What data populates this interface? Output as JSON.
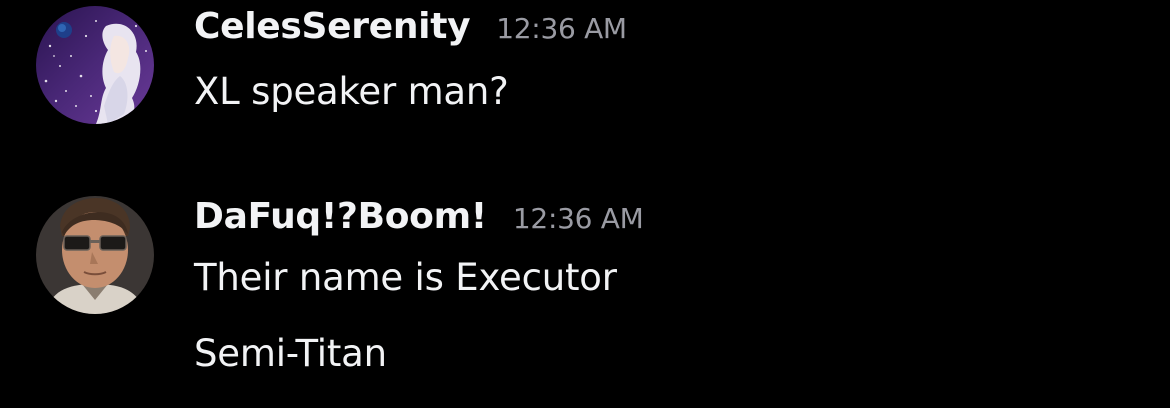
{
  "messages": [
    {
      "author": "CelesSerenity",
      "timestamp": "12:36 AM",
      "lines": [
        "XL speaker man?"
      ]
    },
    {
      "author": "DaFuq!?Boom!",
      "timestamp": "12:36 AM",
      "lines": [
        "Their name is Executor",
        "Semi-Titan"
      ]
    }
  ],
  "colors": {
    "background": "#000000",
    "text": "#f2f3f5",
    "timestamp": "#9a9ba3"
  }
}
